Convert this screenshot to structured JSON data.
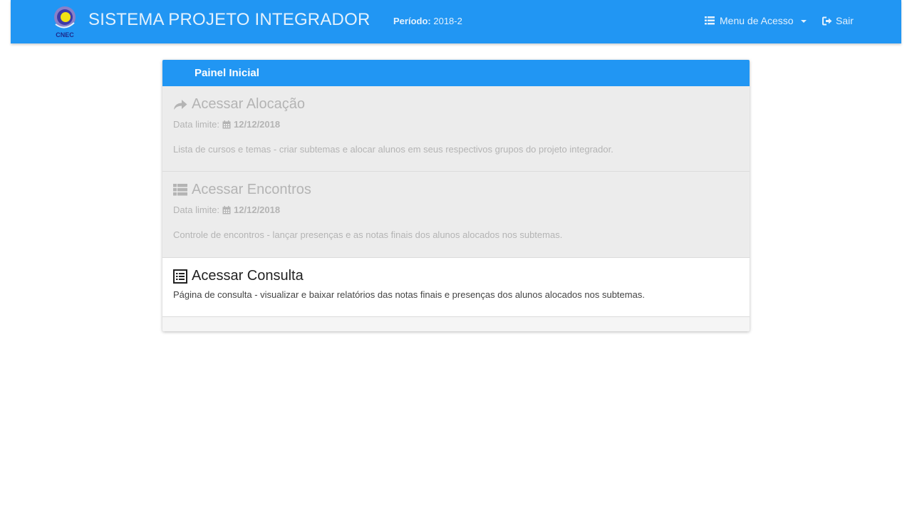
{
  "header": {
    "logo_text": "CNEC",
    "title": "SISTEMA PROJETO INTEGRADOR",
    "period_label": "Período:",
    "period_value": "2018-2",
    "menu_label": "Menu de Acesso",
    "exit_label": "Sair"
  },
  "panel": {
    "title": "Painel Inicial",
    "items": [
      {
        "title": "Acessar Alocação",
        "deadline_label": "Data limite:",
        "deadline_value": "12/12/2018",
        "description": "Lista de cursos e temas - criar subtemas e alocar alunos em seus respectivos grupos do projeto integrador.",
        "icon": "share-arrow-icon",
        "enabled": false
      },
      {
        "title": "Acessar Encontros",
        "deadline_label": "Data limite:",
        "deadline_value": "12/12/2018",
        "description": "Controle de encontros - lançar presenças e as notas finais dos alunos alocados nos subtemas.",
        "icon": "list-icon",
        "enabled": false
      },
      {
        "title": "Acessar Consulta",
        "description": "Página de consulta - visualizar e baixar relatórios das notas finais e presenças dos alunos alocados nos subtemas.",
        "icon": "list-alt-icon",
        "enabled": true
      }
    ]
  },
  "colors": {
    "primary": "#2196f3",
    "disabled_bg": "#ececec",
    "disabled_text": "#b4b4b4"
  }
}
